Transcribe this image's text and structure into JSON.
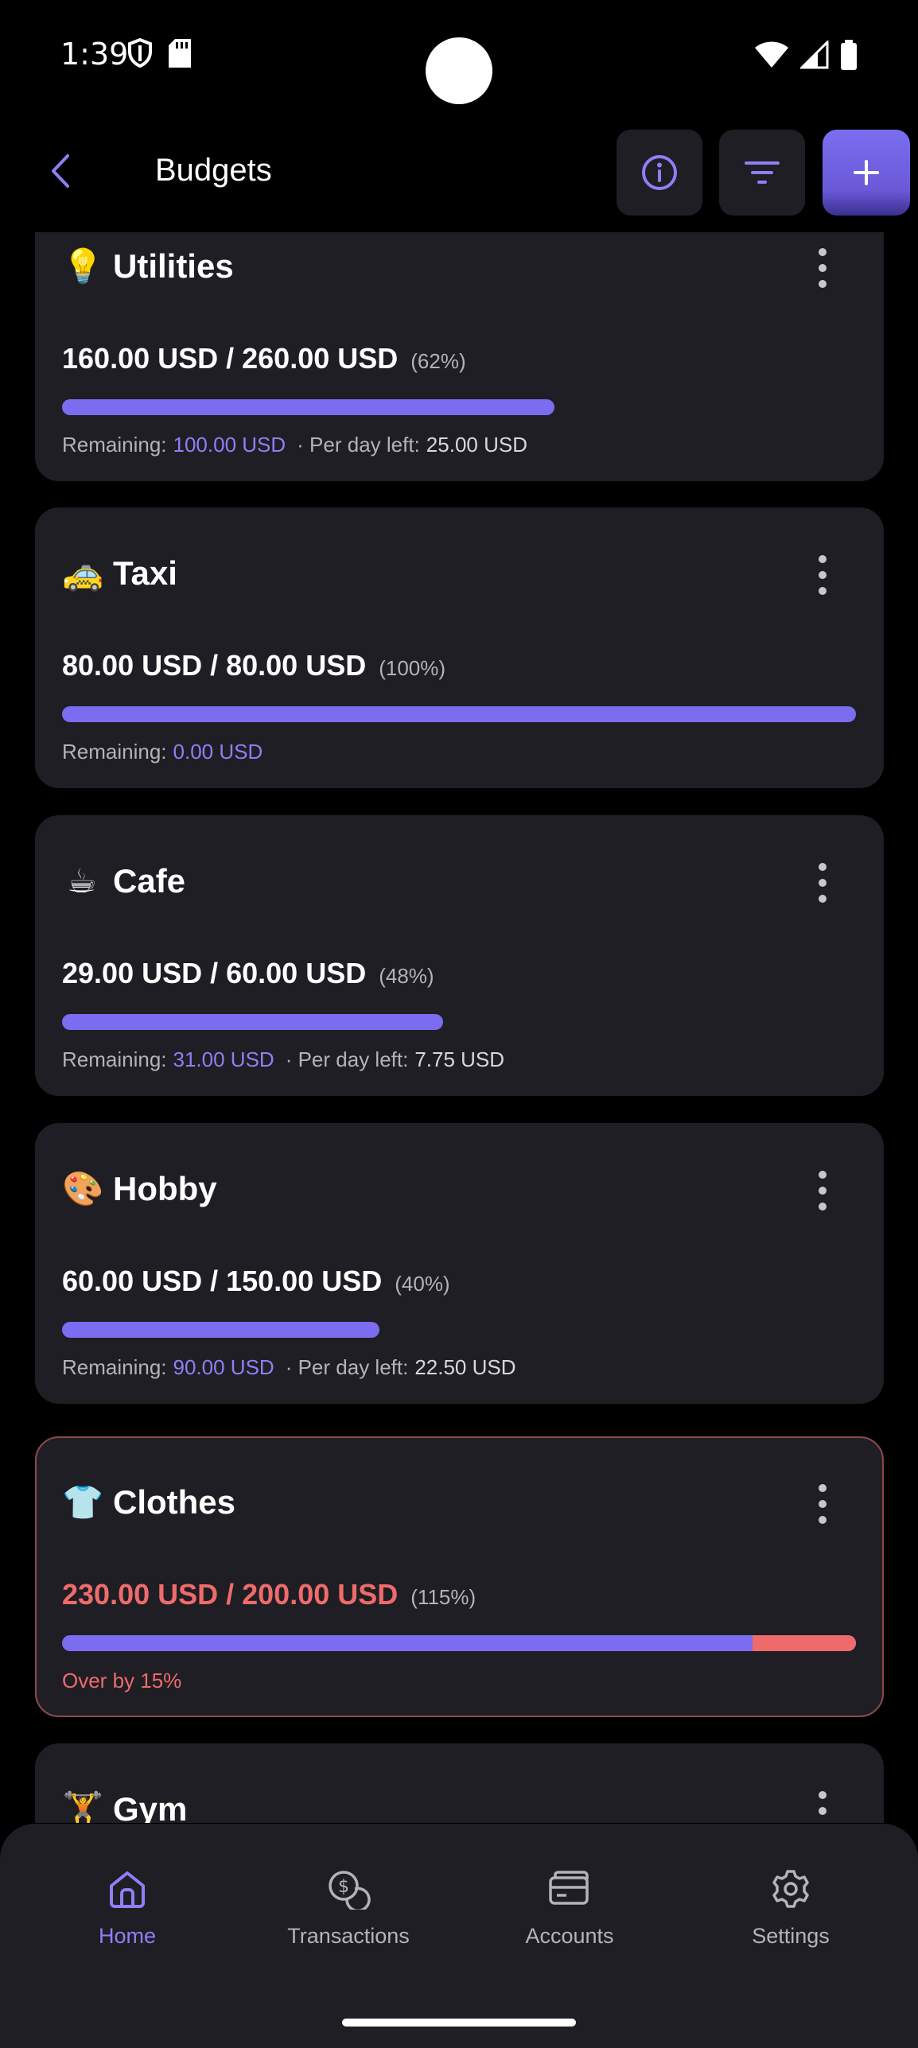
{
  "status_bar": {
    "time": "1:39"
  },
  "header": {
    "title": "Budgets",
    "info_icon": "info-icon",
    "filter_icon": "filter-icon",
    "add_icon": "plus-icon"
  },
  "colors": {
    "accent": "#7b6cf0",
    "accent_text": "#8d80f5",
    "danger": "#ef6b6b",
    "card_bg": "#1f1e24",
    "background": "#000000"
  },
  "budgets": [
    {
      "emoji": "💡",
      "name": "Utilities",
      "spent": "160.00 USD",
      "limit": "260.00 USD",
      "amount_text": "160.00 USD / 260.00 USD",
      "percent_text": "(62%)",
      "progress": 0.62,
      "remaining_label": "Remaining:",
      "remaining_value": "100.00 USD",
      "per_day_label": "· Per day left:",
      "per_day_value": "25.00 USD"
    },
    {
      "emoji": "🚕",
      "name": "Taxi",
      "amount_text": "80.00 USD / 80.00 USD",
      "percent_text": "(100%)",
      "progress": 1.0,
      "remaining_label": "Remaining:",
      "remaining_value": "0.00 USD"
    },
    {
      "emoji": "☕",
      "name": "Cafe",
      "amount_text": "29.00 USD / 60.00 USD",
      "percent_text": "(48%)",
      "progress": 0.48,
      "remaining_label": "Remaining:",
      "remaining_value": "31.00 USD",
      "per_day_label": "· Per day left:",
      "per_day_value": "7.75 USD"
    },
    {
      "emoji": "🎨",
      "name": "Hobby",
      "amount_text": "60.00 USD / 150.00 USD",
      "percent_text": "(40%)",
      "progress": 0.4,
      "remaining_label": "Remaining:",
      "remaining_value": "90.00 USD",
      "per_day_label": "· Per day left:",
      "per_day_value": "22.50 USD"
    },
    {
      "emoji": "👕",
      "name": "Clothes",
      "amount_text": "230.00 USD / 200.00 USD",
      "percent_text": "(115%)",
      "progress": 1.15,
      "over_text": "Over by 15%"
    },
    {
      "emoji": "🏋",
      "name": "Gym"
    }
  ],
  "bottom_nav": [
    {
      "label": "Home",
      "icon": "home-icon",
      "active": true
    },
    {
      "label": "Transactions",
      "icon": "transactions-icon",
      "active": false
    },
    {
      "label": "Accounts",
      "icon": "wallet-icon",
      "active": false
    },
    {
      "label": "Settings",
      "icon": "gear-icon",
      "active": false
    }
  ]
}
